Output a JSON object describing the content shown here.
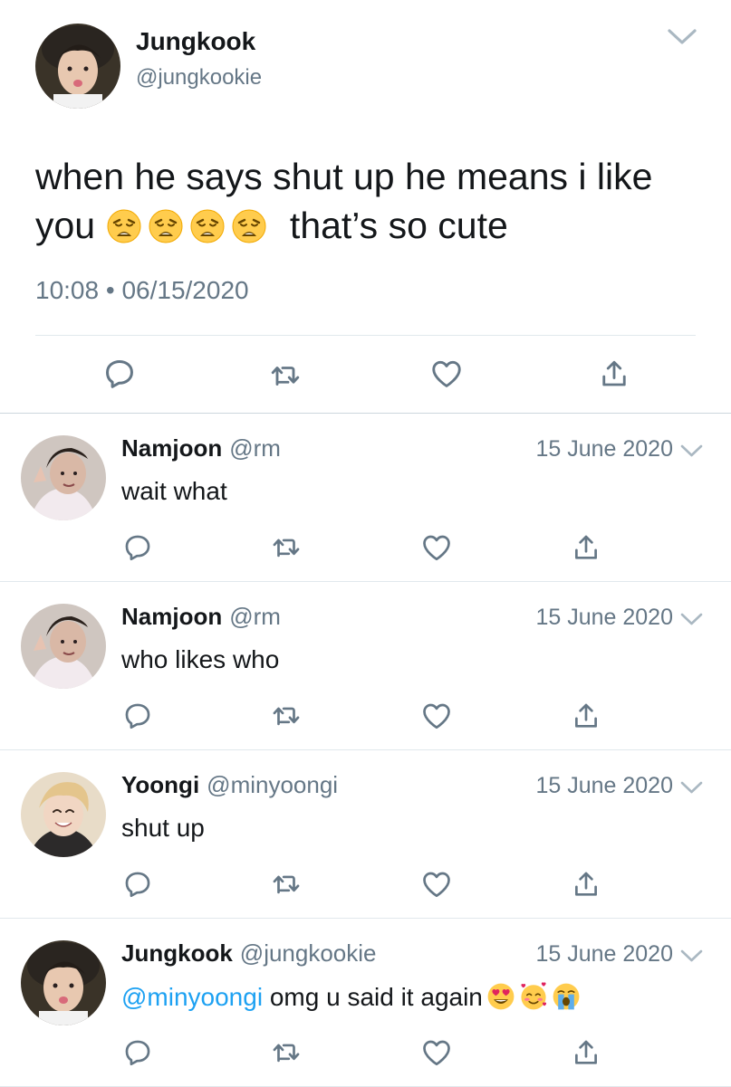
{
  "main_tweet": {
    "name": "Jungkook",
    "handle": "@jungkookie",
    "text_before": "when he says shut up he means i like you",
    "emojis": [
      "weary-face",
      "weary-face",
      "weary-face",
      "weary-face"
    ],
    "text_after": "that’s so cute",
    "time": "10:08",
    "separator": "•",
    "date": "06/15/2020",
    "actions": [
      "reply-icon",
      "retweet-icon",
      "like-icon",
      "share-icon"
    ]
  },
  "replies": [
    {
      "name": "Namjoon",
      "handle": "@rm",
      "date": "15 June 2020",
      "mention": "",
      "text": "wait what",
      "emojis": []
    },
    {
      "name": "Namjoon",
      "handle": "@rm",
      "date": "15 June 2020",
      "mention": "",
      "text": "who likes who",
      "emojis": []
    },
    {
      "name": "Yoongi",
      "handle": "@minyoongi",
      "date": "15 June 2020",
      "mention": "",
      "text": "shut up",
      "emojis": []
    },
    {
      "name": "Jungkook",
      "handle": "@jungkookie",
      "date": "15 June 2020",
      "mention": "@minyoongi",
      "text": " omg u said it again",
      "emojis": [
        "heart-eyes-face",
        "smiling-face-with-hearts",
        "loudly-crying-face"
      ]
    }
  ],
  "colors": {
    "accent": "#1da1f2",
    "secondary_text": "#657786",
    "divider": "#e1e8ed"
  }
}
